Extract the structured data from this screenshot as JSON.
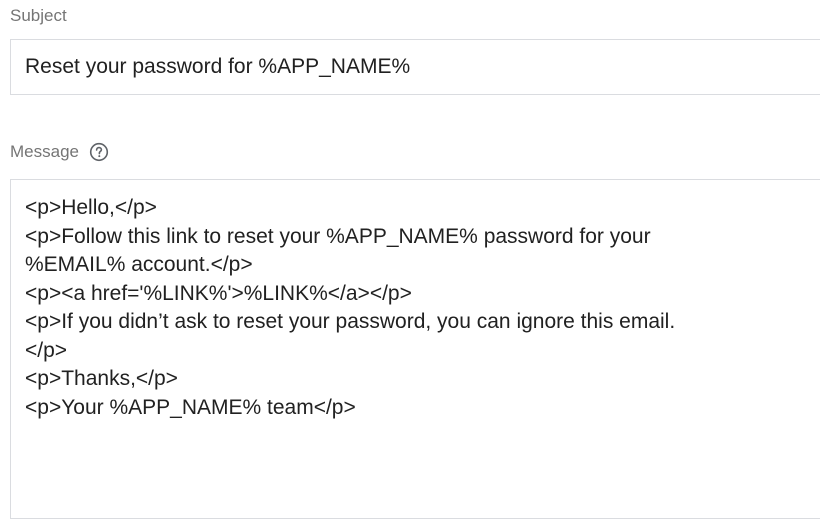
{
  "subject": {
    "label": "Subject",
    "value": "Reset your password for %APP_NAME%"
  },
  "message": {
    "label": "Message",
    "help_icon": "question-circle-icon",
    "value": "<p>Hello,</p>\n<p>Follow this link to reset your %APP_NAME% password for your\n%EMAIL% account.</p>\n<p><a href='%LINK%'>%LINK%</a></p>\n<p>If you didn’t ask to reset your password, you can ignore this email.\n</p>\n<p>Thanks,</p>\n<p>Your %APP_NAME% team</p>"
  }
}
